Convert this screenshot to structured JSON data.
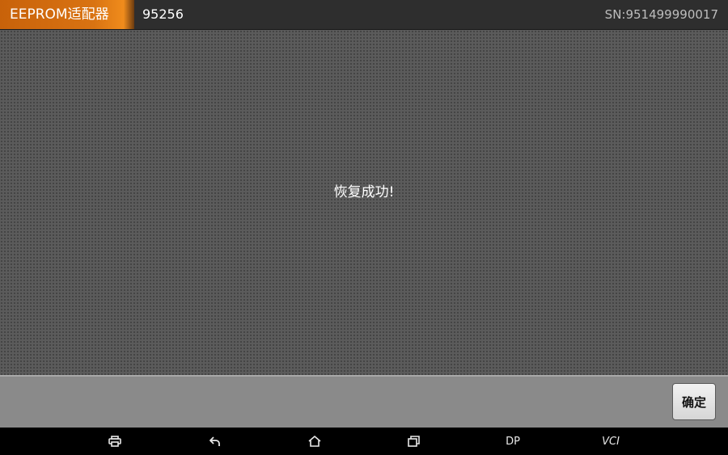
{
  "header": {
    "app_title": "EEPROM适配器",
    "app_code": "95256",
    "serial": "SN:951499990017"
  },
  "main": {
    "message": "恢复成功!"
  },
  "actions": {
    "ok_label": "确定"
  },
  "navbar": {
    "icons": [
      "print-icon",
      "back-icon",
      "home-icon",
      "recent-apps-icon"
    ],
    "dp_label": "DP",
    "vci_label": "VCI"
  },
  "colors": {
    "accent": "#d97312",
    "header_bg": "#2e2e2e",
    "content_bg": "#5b5b5b",
    "action_bar_bg": "#8a8a8a"
  }
}
